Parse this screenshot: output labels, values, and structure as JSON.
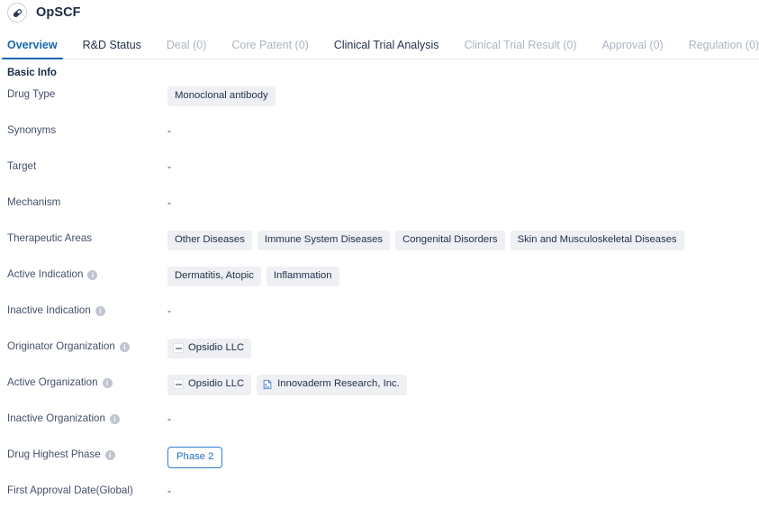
{
  "header": {
    "title": "OpSCF",
    "avatar_icon": "capsule-pill-icon"
  },
  "tabs": [
    {
      "label": "Overview",
      "state": "active"
    },
    {
      "label": "R&D Status",
      "state": "dark"
    },
    {
      "label": "Deal (0)",
      "state": "muted"
    },
    {
      "label": "Core Patent (0)",
      "state": "muted"
    },
    {
      "label": "Clinical Trial Analysis",
      "state": "dark"
    },
    {
      "label": "Clinical Trial Result (0)",
      "state": "muted"
    },
    {
      "label": "Approval (0)",
      "state": "muted"
    },
    {
      "label": "Regulation (0)",
      "state": "muted"
    }
  ],
  "section": {
    "title": "Basic Info"
  },
  "rows": [
    {
      "label": "Drug Type",
      "info": false,
      "type": "tags",
      "tags": [
        {
          "text": "Monoclonal antibody"
        }
      ]
    },
    {
      "label": "Synonyms",
      "info": false,
      "type": "empty",
      "empty_text": "-"
    },
    {
      "label": "Target",
      "info": false,
      "type": "empty",
      "empty_text": "-"
    },
    {
      "label": "Mechanism",
      "info": false,
      "type": "empty",
      "empty_text": "-"
    },
    {
      "label": "Therapeutic Areas",
      "info": false,
      "type": "tags",
      "tags": [
        {
          "text": "Other Diseases"
        },
        {
          "text": "Immune System Diseases"
        },
        {
          "text": "Congenital Disorders"
        },
        {
          "text": "Skin and Musculoskeletal Diseases"
        }
      ]
    },
    {
      "label": "Active Indication",
      "info": true,
      "type": "tags",
      "tags": [
        {
          "text": "Dermatitis, Atopic"
        },
        {
          "text": "Inflammation"
        }
      ]
    },
    {
      "label": "Inactive Indication",
      "info": true,
      "type": "empty",
      "empty_text": "-"
    },
    {
      "label": "Originator Organization",
      "info": true,
      "type": "orgs",
      "tags": [
        {
          "text": "Opsidio LLC",
          "icon": "company-logo-placeholder-icon"
        }
      ]
    },
    {
      "label": "Active Organization",
      "info": true,
      "type": "orgs",
      "tags": [
        {
          "text": "Opsidio LLC",
          "icon": "company-logo-placeholder-icon"
        },
        {
          "text": "Innovaderm Research, Inc.",
          "icon": "company-building-icon"
        }
      ]
    },
    {
      "label": "Inactive Organization",
      "info": true,
      "type": "empty",
      "empty_text": "-"
    },
    {
      "label": "Drug Highest Phase",
      "info": true,
      "type": "badge",
      "badge": {
        "text": "Phase 2"
      }
    },
    {
      "label": "First Approval Date(Global)",
      "info": false,
      "type": "empty",
      "empty_text": "-"
    }
  ],
  "colors": {
    "accent": "#1566b7",
    "tag_bg": "#eef0f3",
    "label": "#44506a",
    "phase_border": "#2f7fd1",
    "phase_text": "#1f6fc4"
  }
}
